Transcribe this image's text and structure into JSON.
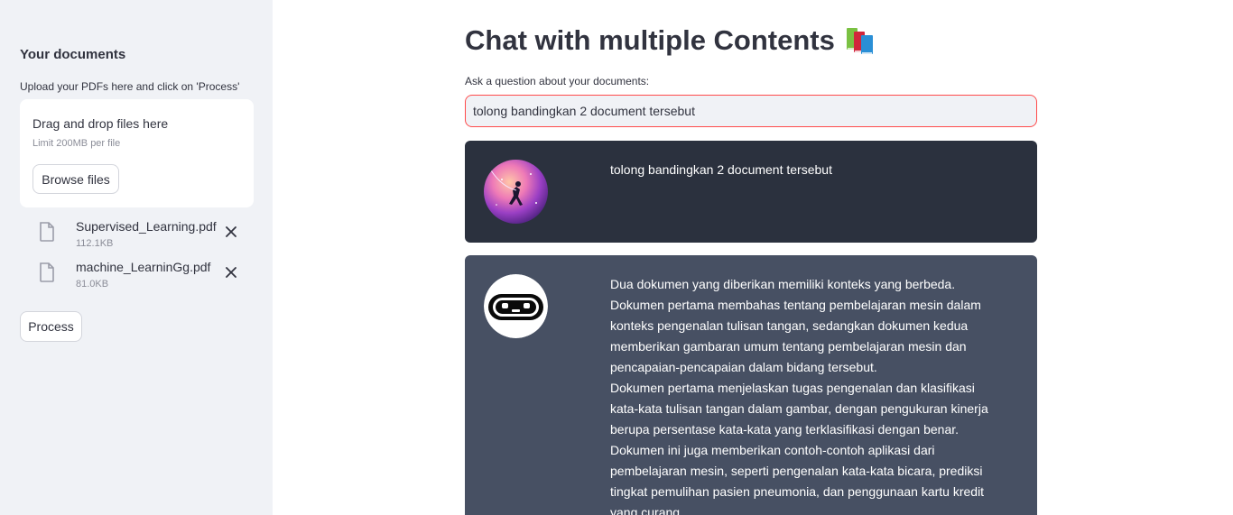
{
  "sidebar": {
    "title": "Your documents",
    "hint": "Upload your PDFs here and click on 'Process'",
    "uploader": {
      "title": "Drag and drop files here",
      "limit": "Limit 200MB per file",
      "browse_label": "Browse files"
    },
    "files": [
      {
        "name": "Supervised_Learning.pdf",
        "size": "112.1KB"
      },
      {
        "name": "machine_LearninGg.pdf",
        "size": "81.0KB"
      }
    ],
    "process_label": "Process"
  },
  "main": {
    "title": "Chat with multiple Contents",
    "question_label": "Ask a question about your documents:",
    "question_value": "tolong bandingkan 2 document tersebut"
  },
  "chat": {
    "user_message": "tolong bandingkan 2 document tersebut",
    "bot_paragraphs": [
      "Dua dokumen yang diberikan memiliki konteks yang berbeda. Dokumen pertama membahas tentang pembelajaran mesin dalam konteks pengenalan tulisan tangan, sedangkan dokumen kedua memberikan gambaran umum tentang pembelajaran mesin dan pencapaian-pencapaian dalam bidang tersebut.",
      "Dokumen pertama menjelaskan tugas pengenalan dan klasifikasi kata-kata tulisan tangan dalam gambar, dengan pengukuran kinerja berupa persentase kata-kata yang terklasifikasi dengan benar. Dokumen ini juga memberikan contoh-contoh aplikasi dari pembelajaran mesin, seperti pengenalan kata-kata bicara, prediksi tingkat pemulihan pasien pneumonia, dan penggunaan kartu kredit yang curang."
    ]
  },
  "icons": {
    "title_emoji": "books-icon",
    "file": "file-icon",
    "remove": "close-icon",
    "user_avatar": "user-avatar",
    "bot_avatar": "bot-avatar"
  },
  "colors": {
    "sidebar_bg": "#f0f2f6",
    "input_focus_border": "#ff4b4b",
    "user_msg_bg": "#2b313e",
    "bot_msg_bg": "#475063"
  }
}
